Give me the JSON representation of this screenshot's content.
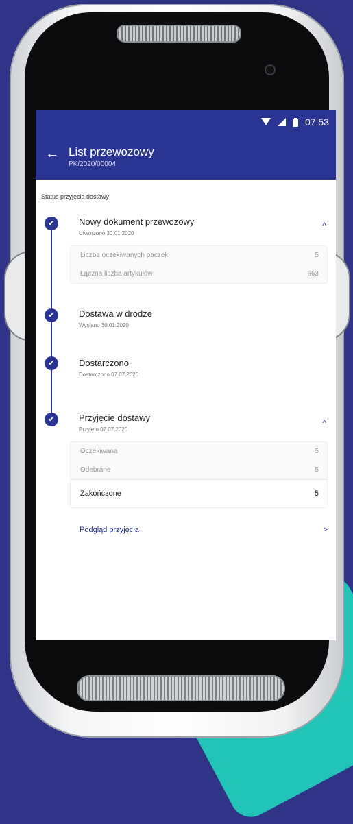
{
  "status_bar": {
    "time": "07:53"
  },
  "header": {
    "back_icon": "arrow-left-icon",
    "title": "List przewozowy",
    "subtitle": "PK/2020/00004"
  },
  "section_label": "Status przyjęcia dostawy",
  "colors": {
    "primary": "#2a3593",
    "background": "#2f3486",
    "accent": "#22c4b7"
  },
  "steps": [
    {
      "title": "Nowy dokument przewozowy",
      "date": "Utworzono 30.01.2020",
      "expanded": true,
      "details": [
        {
          "label": "Liczba oczekiwanych paczek",
          "value": "5"
        },
        {
          "label": "Łączna liczba artykułów",
          "value": "663"
        }
      ]
    },
    {
      "title": "Dostawa w drodze",
      "date": "Wysłano 30.01.2020"
    },
    {
      "title": "Dostarczono",
      "date": "Dostarczono 07.07.2020"
    },
    {
      "title": "Przyjęcie dostawy",
      "date": "Przyjęto 07.07.2020",
      "expanded": true,
      "details": [
        {
          "label": "Oczekiwana",
          "value": "5"
        },
        {
          "label": "Odebrane",
          "value": "5"
        },
        {
          "label": "Zakończone",
          "value": "5"
        }
      ],
      "link": "Podgląd przyjęcia"
    }
  ]
}
